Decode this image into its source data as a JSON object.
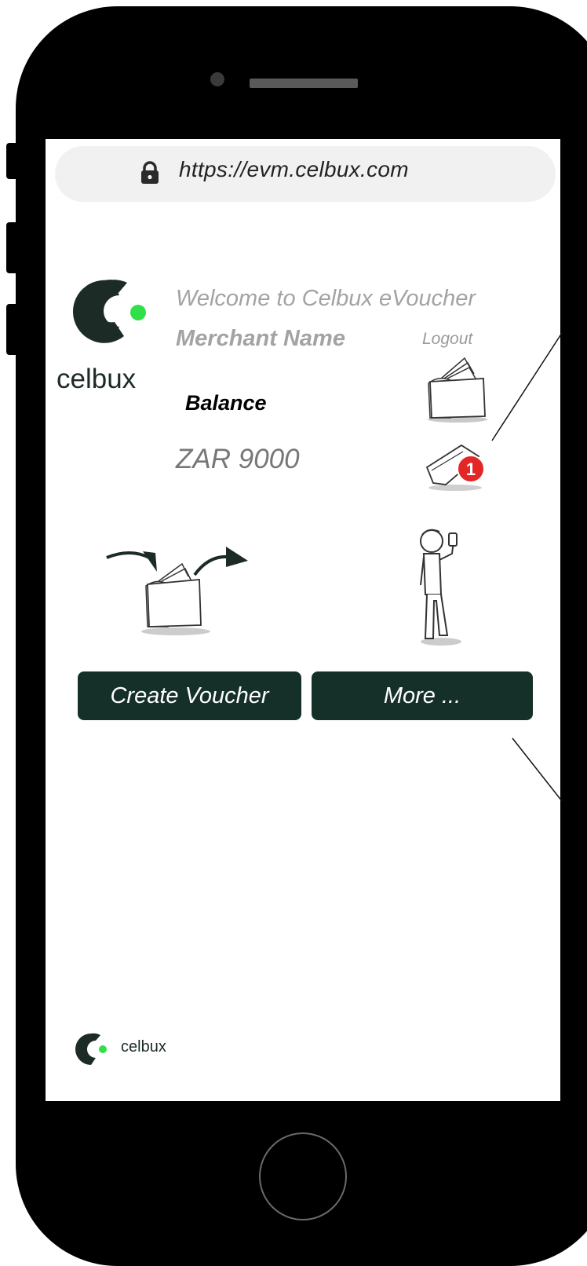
{
  "browser": {
    "url": "https://evm.celbux.com"
  },
  "header": {
    "brand": "celbux",
    "welcome": "Welcome to Celbux eVoucher",
    "merchant_name": "Merchant Name",
    "logout_label": "Logout"
  },
  "balance": {
    "label": "Balance",
    "value": "ZAR 9000"
  },
  "notifications": {
    "count": "1"
  },
  "actions": {
    "create_voucher": "Create Voucher",
    "more": "More ..."
  },
  "footer": {
    "brand": "celbux"
  },
  "colors": {
    "brand_dark": "#153029",
    "brand_green": "#2fe04a",
    "badge_red": "#e32626"
  },
  "icons": {
    "lock": "lock-icon",
    "wallet": "wallet-icon",
    "notification": "voucher-notification-icon",
    "person": "person-phone-icon"
  }
}
